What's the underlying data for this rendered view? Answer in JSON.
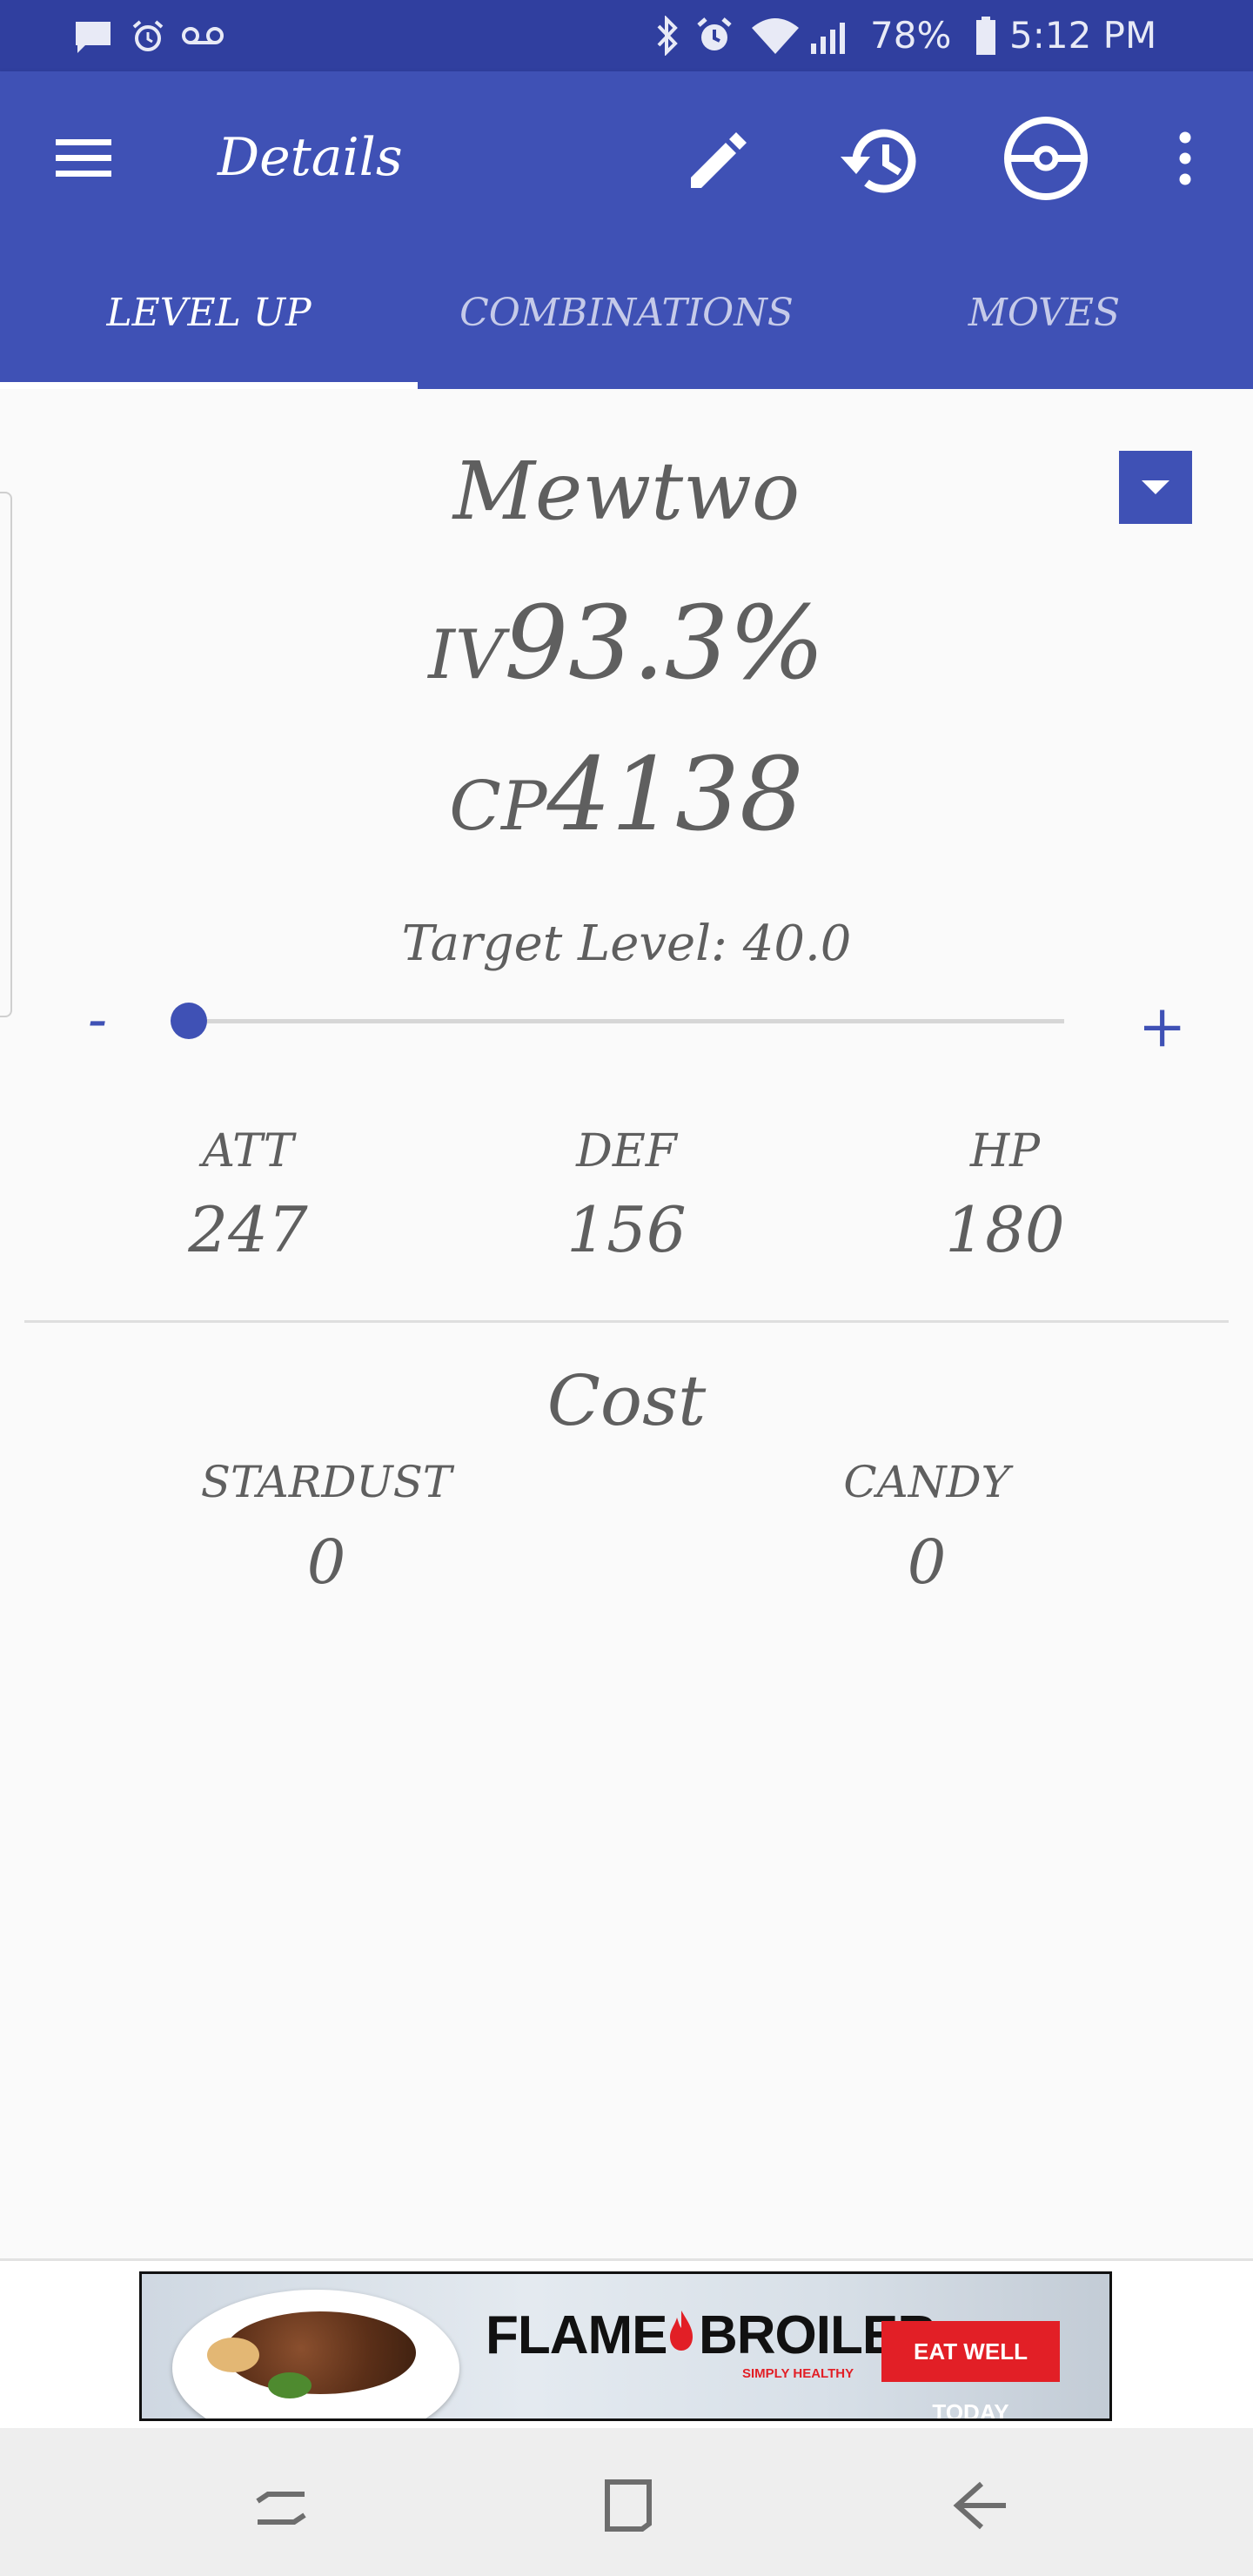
{
  "status_bar": {
    "battery": "78%",
    "time": "5:12 PM",
    "left_icons": [
      "message-icon",
      "alarm-icon",
      "voicemail-icon"
    ],
    "right_icons": [
      "bluetooth-icon",
      "alarm-icon",
      "wifi-icon",
      "signal-icon",
      "battery-icon"
    ]
  },
  "app_bar": {
    "title": "Details",
    "icons": [
      "menu-icon",
      "edit-icon",
      "history-icon",
      "pokeball-icon",
      "more-vert-icon"
    ]
  },
  "tabs": [
    {
      "label": "LEVEL UP",
      "active": true
    },
    {
      "label": "COMBINATIONS",
      "active": false
    },
    {
      "label": "MOVES",
      "active": false
    }
  ],
  "pokemon": {
    "name": "Mewtwo",
    "iv_prefix": "IV",
    "iv_value": "93.3%",
    "cp_prefix": "CP",
    "cp_value": "4138"
  },
  "level": {
    "label": "Target Level: 40.0",
    "minus": "-",
    "plus": "+",
    "slider_fraction": 0.0
  },
  "stats": [
    {
      "label": "ATT",
      "value": "247"
    },
    {
      "label": "DEF",
      "value": "156"
    },
    {
      "label": "HP",
      "value": "180"
    }
  ],
  "cost": {
    "title": "Cost",
    "items": [
      {
        "label": "STARDUST",
        "value": "0"
      },
      {
        "label": "CANDY",
        "value": "0"
      }
    ]
  },
  "ad": {
    "brand_left": "FLAME",
    "brand_right": "BROILER",
    "tagline": "SIMPLY HEALTHY",
    "cta": "EAT WELL TODAY"
  },
  "colors": {
    "primary": "#3F51B5",
    "primary_dark": "#303F9F",
    "text": "#5f5f5f",
    "ad_red": "#E21F26"
  }
}
